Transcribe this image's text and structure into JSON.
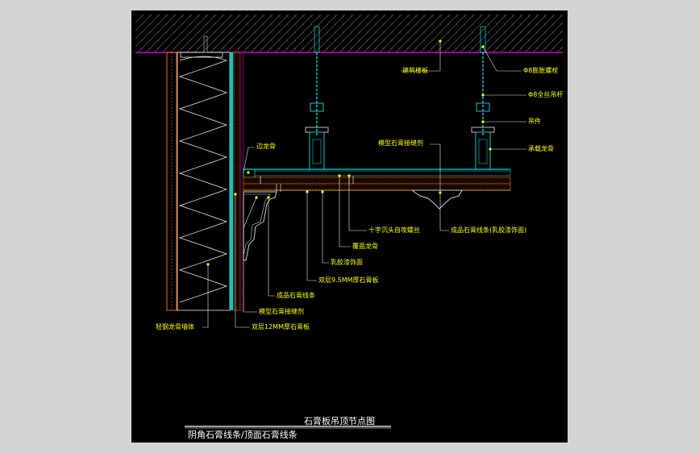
{
  "labels": {
    "building_slab": "建筑楼板",
    "expansion_bolt": "Φ8膨胀螺栓",
    "full_thread_rod": "Φ8全丝吊杆",
    "hanger": "吊件",
    "main_keel": "承载龙骨",
    "edge_keel": "边龙骨",
    "gypsum_joint": "模型石膏接缝剂",
    "cross_screw": "十字沉头自攻螺丝",
    "cover_keel": "覆面龙骨",
    "latex_paint": "乳胶漆饰面",
    "double_gypsum_95": "双层9.5MM厚石膏板",
    "finished_moulding": "成品石膏线条",
    "gypsum_joint_2": "模型石膏接缝剂",
    "double_gypsum_12": "双层12MM厚石膏板",
    "steel_stud_wall": "轻钢龙骨墙体",
    "finished_moulding_paint": "成品石膏线条(乳胶漆饰面)"
  },
  "title": "石膏板吊顶节点图",
  "subtitle": "阴角石膏线条/顶面石膏线条",
  "colors": {
    "background": "#000000",
    "label": "#ffff00",
    "leader_dot": "#ffff00",
    "slab_line": "#cc00cc",
    "keel_cyan": "#00cccc",
    "board_orange": "#ff6600",
    "hatch_gray": "#8a8a8a",
    "insulation_white": "#e8e8e8",
    "title": "#ffffff"
  }
}
